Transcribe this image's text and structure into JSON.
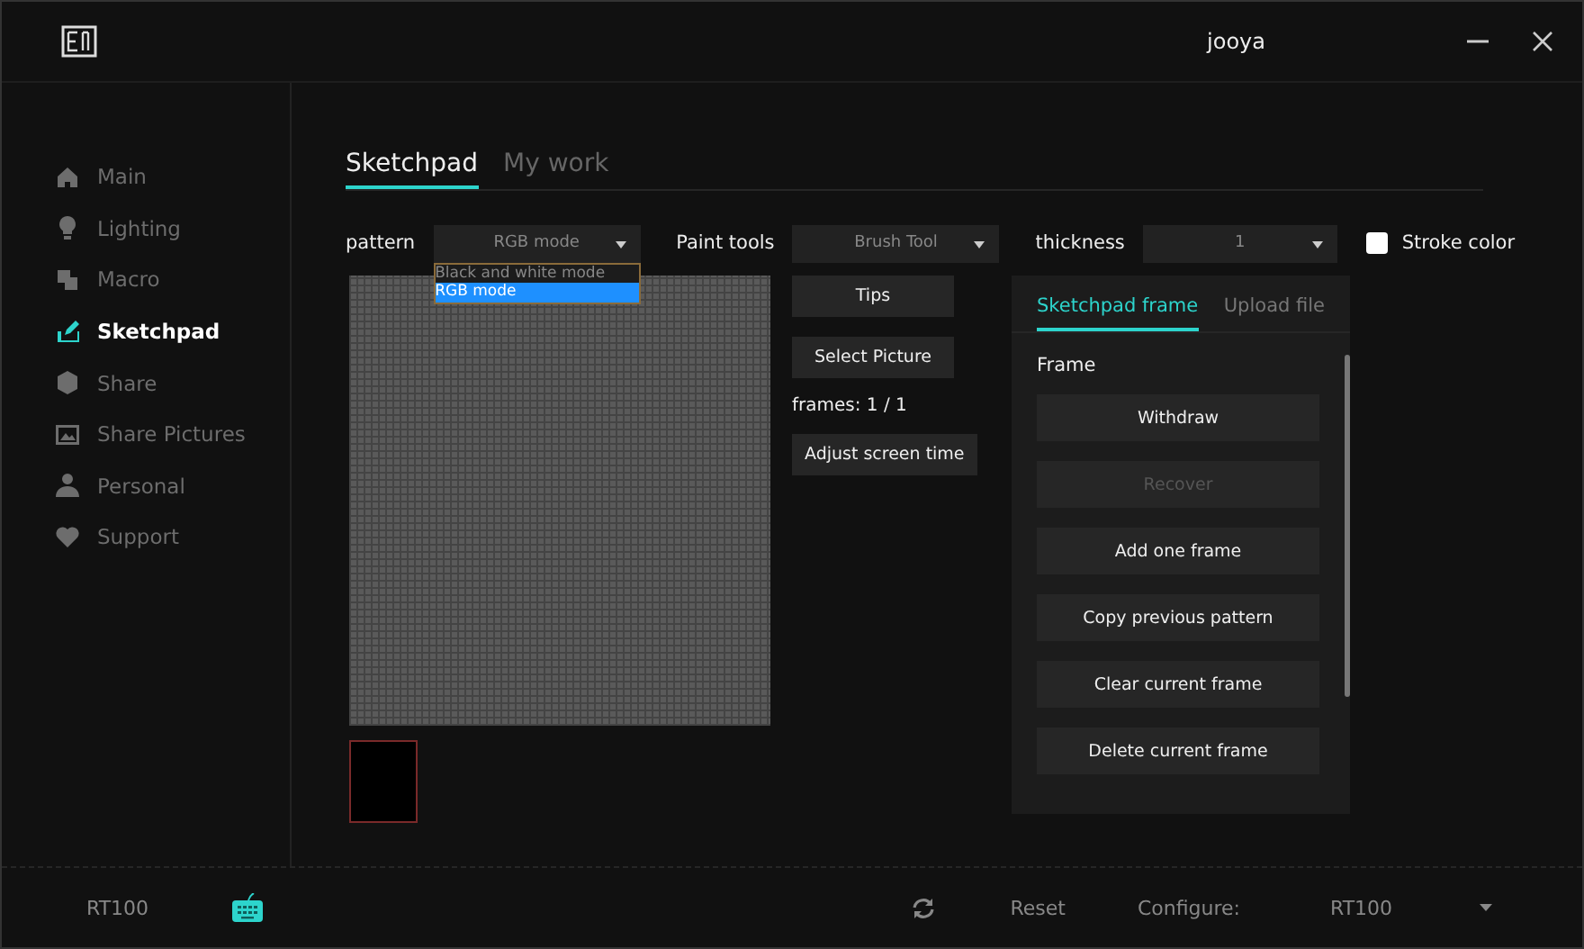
{
  "window": {
    "user": "jooya"
  },
  "sidebar": {
    "items": [
      {
        "label": "Main",
        "selected": false
      },
      {
        "label": "Lighting",
        "selected": false
      },
      {
        "label": "Macro",
        "selected": false
      },
      {
        "label": "Sketchpad",
        "selected": true
      },
      {
        "label": "Share",
        "selected": false
      },
      {
        "label": "Share Pictures",
        "selected": false
      },
      {
        "label": "Personal",
        "selected": false
      },
      {
        "label": "Support",
        "selected": false
      }
    ]
  },
  "tabs": [
    {
      "label": "Sketchpad",
      "selected": true
    },
    {
      "label": "My work",
      "selected": false
    }
  ],
  "toolbar": {
    "pattern": {
      "label": "pattern",
      "value": "RGB mode",
      "options": [
        {
          "label": "Black and white mode",
          "selected": false
        },
        {
          "label": "RGB mode",
          "selected": true
        }
      ]
    },
    "paint_tools": {
      "label": "Paint tools",
      "value": "Brush Tool"
    },
    "thickness": {
      "label": "thickness",
      "value": "1"
    },
    "stroke_color": {
      "label": "Stroke color",
      "checked": false
    }
  },
  "actions": {
    "tips": "Tips",
    "select_picture": "Select Picture",
    "frames": "frames: 1 / 1",
    "adjust": "Adjust screen time"
  },
  "panel": {
    "tabs": [
      {
        "label": "Sketchpad frame",
        "selected": true
      },
      {
        "label": "Upload file",
        "selected": false
      }
    ],
    "heading": "Frame",
    "buttons": [
      {
        "label": "Withdraw",
        "disabled": false
      },
      {
        "label": "Recover",
        "disabled": true
      },
      {
        "label": "Add one frame",
        "disabled": false
      },
      {
        "label": "Copy previous pattern",
        "disabled": false
      },
      {
        "label": "Clear current frame",
        "disabled": false
      },
      {
        "label": "Delete current frame",
        "disabled": false
      }
    ]
  },
  "footer": {
    "device": "RT100",
    "reset": "Reset",
    "configure": "Configure:",
    "config_value": "RT100"
  }
}
